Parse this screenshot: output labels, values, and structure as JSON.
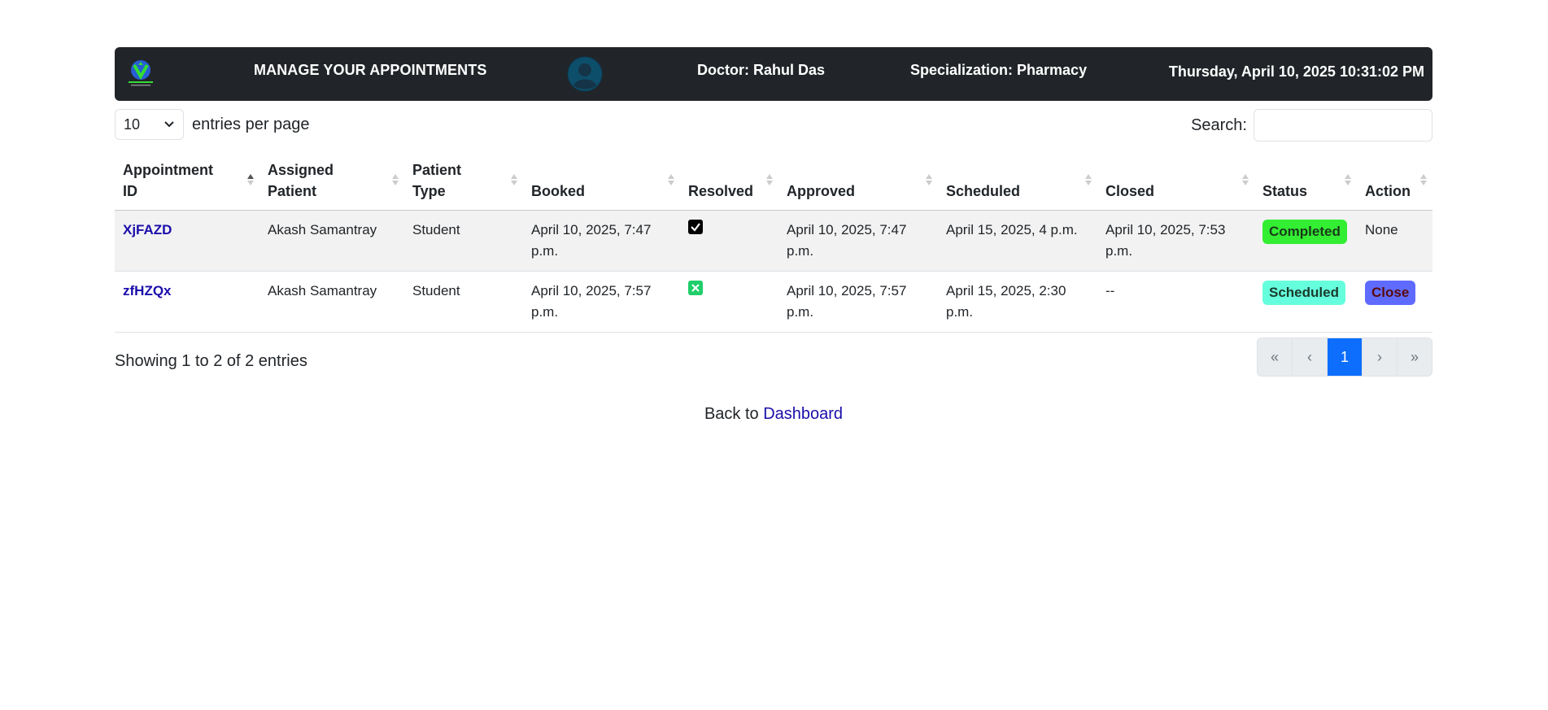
{
  "header": {
    "title": "MANAGE YOUR APPOINTMENTS",
    "doctor": "Doctor: Rahul Das",
    "specialization": "Specialization: Pharmacy",
    "datetime": "Thursday, April 10, 2025 10:31:02 PM",
    "logo_icon": "medical-logo-icon",
    "avatar_icon": "user-avatar-icon"
  },
  "controls": {
    "page_length": "10",
    "entries_label": "entries per page",
    "search_label": "Search:",
    "search_value": ""
  },
  "table": {
    "columns": [
      {
        "line1": "Appointment",
        "line2": "ID",
        "sort": "asc"
      },
      {
        "line1": "Assigned",
        "line2": "Patient",
        "sort": "none"
      },
      {
        "line1": "Patient",
        "line2": "Type",
        "sort": "none"
      },
      {
        "line1": "",
        "line2": "Booked",
        "sort": "none"
      },
      {
        "line1": "",
        "line2": "Resolved",
        "sort": "none"
      },
      {
        "line1": "",
        "line2": "Approved",
        "sort": "none"
      },
      {
        "line1": "",
        "line2": "Scheduled",
        "sort": "none"
      },
      {
        "line1": "",
        "line2": "Closed",
        "sort": "none"
      },
      {
        "line1": "",
        "line2": "Status",
        "sort": "none"
      },
      {
        "line1": "",
        "line2": "Action",
        "sort": "none"
      }
    ],
    "rows": [
      {
        "id": "XjFAZD",
        "patient": "Akash Samantray",
        "type": "Student",
        "booked": "April 10, 2025, 7:47 p.m.",
        "resolved": "checked",
        "approved": "April 10, 2025, 7:47 p.m.",
        "scheduled": "April 15, 2025, 4 p.m.",
        "closed": "April 10, 2025, 7:53 p.m.",
        "status": "Completed",
        "action": "None"
      },
      {
        "id": "zfHZQx",
        "patient": "Akash Samantray",
        "type": "Student",
        "booked": "April 10, 2025, 7:57 p.m.",
        "resolved": "unchecked",
        "approved": "April 10, 2025, 7:57 p.m.",
        "scheduled": "April 15, 2025, 2:30 p.m.",
        "closed": "--",
        "status": "Scheduled",
        "action": "Close"
      }
    ]
  },
  "footer": {
    "info": "Showing 1 to 2 of 2 entries",
    "pager": {
      "first": "«",
      "prev": "‹",
      "current": "1",
      "next": "›",
      "last": "»"
    },
    "back_text": "Back to ",
    "back_link": "Dashboard"
  },
  "colors": {
    "header_bg": "#212529",
    "completed": "#33ee33",
    "scheduled": "#66ffdd",
    "close_button": "#5f6bff",
    "pager_active": "#0d6efd"
  }
}
